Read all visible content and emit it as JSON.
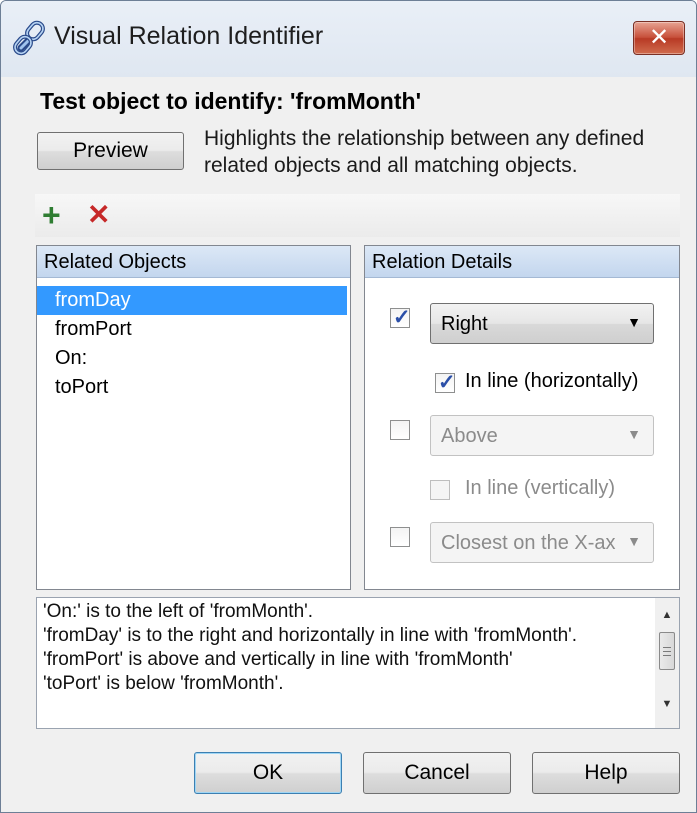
{
  "window": {
    "title": "Visual Relation Identifier",
    "close_glyph": "✕",
    "app_icon": "chain-link-icon"
  },
  "heading": "Test object to identify: 'fromMonth'",
  "preview": {
    "button_label": "Preview",
    "description_lines": [
      "Highlights the relationship between any defined",
      "related objects and all matching objects."
    ]
  },
  "toolbar": {
    "add_glyph": "+",
    "delete_glyph": "✕",
    "add_color": "#2f7d32",
    "delete_color": "#c62828"
  },
  "related_objects": {
    "header": "Related Objects",
    "items": [
      "fromDay",
      "fromPort",
      "On:",
      "toPort"
    ],
    "selected": "fromDay"
  },
  "relation_details": {
    "header": "Relation Details",
    "horizontal": {
      "checked": true,
      "value": "Right",
      "inline_label": "In line (horizontally)",
      "inline_checked": true
    },
    "vertical": {
      "checked": false,
      "value": "Above",
      "inline_label": "In line (vertically)",
      "inline_checked": false
    },
    "closest": {
      "checked": false,
      "value": "Closest on the X-ax"
    }
  },
  "summary_lines": [
    "'On:' is to the left of 'fromMonth'.",
    "'fromDay' is to the right and horizontally in line with 'fromMonth'.",
    "'fromPort' is above and vertically in line with 'fromMonth'",
    "'toPort' is below 'fromMonth'."
  ],
  "buttons": {
    "ok": "OK",
    "cancel": "Cancel",
    "help": "Help"
  },
  "colors": {
    "selection": "#3399ff",
    "panel_header": "#c3d6ee",
    "close_button": "#c7503a"
  }
}
